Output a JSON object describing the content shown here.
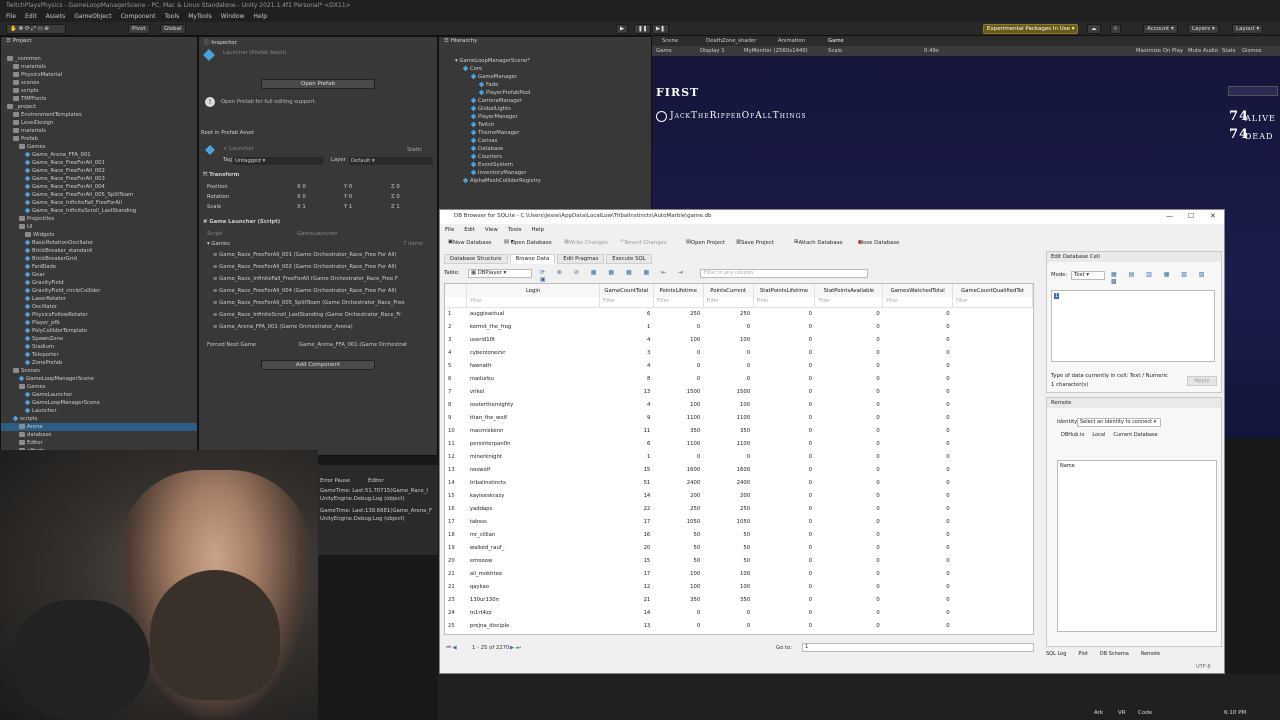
{
  "unity": {
    "title": "TwitchPlaysPhysics - GameLoopManagerScene - PC, Mac & Linux Standalone - Unity 2021.1.4f1 Personal* <DX11>",
    "menu": [
      "File",
      "Edit",
      "Assets",
      "GameObject",
      "Component",
      "Tools",
      "MyTools",
      "Window",
      "Help"
    ],
    "toolbar": {
      "pivot": "Pivot",
      "global": "Global",
      "experimental": "Experimental Packages In Use",
      "account": "Account",
      "layers": "Layers",
      "layout": "Layout"
    }
  },
  "project": {
    "tab": "Project",
    "items": [
      "_common",
      "materials",
      "PhysicsMaterial",
      "scenes",
      "scripts",
      "TMPFonts",
      "_project",
      "EnvironmentTemplates",
      "LevelDesign",
      "materials",
      "Prefab",
      "Games",
      "Game_Arena_FFA_001",
      "Game_Race_FreeForAll_001",
      "Game_Race_FreeForAll_002",
      "Game_Race_FreeForAll_003",
      "Game_Race_FreeForAll_004",
      "Game_Race_FreeForAll_005_SplitTeam",
      "Game_Race_InfiniteFall_FreeForAll",
      "Game_Race_InfiniteScroll_LastStanding",
      "Projectiles",
      "UI",
      "Widgets",
      "BasicRotationOscillator",
      "BrickBreaker_standard",
      "BrickBreakerGrid",
      "FanBlade",
      "Gear",
      "GravityField",
      "GravityField_circleCollider",
      "LaserRotator",
      "Oscillator",
      "PhysicsFollowRotator",
      "Player_pfb",
      "PolyColliderTemplate",
      "SpawnZone",
      "Stadium",
      "Teleporter",
      "ZonePrefab",
      "Scenes",
      "GameLoopManagerScene",
      "Games",
      "GameLauncher",
      "GameLoopManagerScene",
      "Launcher",
      "scripts",
      "Arena",
      "database",
      "Editor",
      "effects"
    ],
    "selected_index": 46
  },
  "inspector": {
    "tab": "Inspector",
    "asset_title": "Launcher (Prefab Asset)",
    "open_prefab": "Open Prefab",
    "info": "Open Prefab for full editing support.",
    "root_label": "Root in Prefab Asset",
    "object_name": "Launcher",
    "static": "Static",
    "tag_label": "Tag",
    "tag_value": "Untagged",
    "layer_label": "Layer",
    "layer_value": "Default",
    "transform": "Transform",
    "position": "Position",
    "rotation": "Rotation",
    "scale": "Scale",
    "pos_vals": [
      "0",
      "0",
      "0"
    ],
    "rot_vals": [
      "0",
      "0",
      "0"
    ],
    "scale_vals": [
      "1",
      "1",
      "1"
    ],
    "component": "Game Launcher (Script)",
    "script_label": "Script",
    "script_value": "GameLauncher",
    "games_label": "Games",
    "games_count": "7 items",
    "games": [
      "Game_Race_FreeForAll_001 (Game Orchestrator_Race_Free For All)",
      "Game_Race_FreeForAll_002 (Game Orchestrator_Race_Free For All)",
      "Game_Race_InfiniteFall_FreeForAll (Game Orchestrator_Race_Free F",
      "Game_Race_FreeForAll_004 (Game Orchestrator_Race_Free For All)",
      "Game_Race_FreeForAll_005_SplitTeam (Game Orchestrator_Race_Free",
      "Game_Race_InfiniteScroll_LastStanding (Game Orchestrator_Race_Fr",
      "Game_Arena_FFA_001 (Game Orchestrator_Arena)"
    ],
    "forced_label": "Forced Next Game",
    "forced_value": "Game_Arena_FFA_001 (Game Orchestrat",
    "add_component": "Add Component"
  },
  "hierarchy": {
    "tab": "Hierarchy",
    "scene": "GameLoopManagerScene*",
    "items": [
      "Core",
      "GameManager",
      "Fade",
      "PlayerPrefabPool",
      "CameraManager",
      "GlobalLights",
      "PlayerManager",
      "Twitch",
      "ThemeManager",
      "Canvas",
      "Database",
      "Counters",
      "EventSystem",
      "InventoryManager",
      "AlphaMeshColliderRegistry"
    ]
  },
  "sceneTabs": {
    "tabs": [
      "Scene",
      "DeathZone_shader",
      "Animation",
      "Game"
    ],
    "display": "Display 1",
    "resolution": "MyMonitor (2560x1440)",
    "scale_label": "Scale",
    "scale_value": "0.49x",
    "maximize": "Maximize On Play",
    "mute": "Mute Audio",
    "stats": "Stats",
    "gizmos": "Gizmos",
    "game_mode": "Game"
  },
  "game": {
    "first_label": "FIRST",
    "first_player": "JackTheRipperOfAllThings",
    "alive_count": "74",
    "alive_label": "ALIVE",
    "dead_count": "74",
    "dead_label": "DEAD"
  },
  "console": {
    "tabs": [
      "Error Pause",
      "Editor"
    ],
    "lines": [
      "GameTime: Last:51.70715(Game_Race_I",
      "UnityEngine.Debug:Log (object)",
      "GameTime: Last:138.6681(Game_Arena_F",
      "UnityEngine.Debug:Log (object)"
    ]
  },
  "db": {
    "title": "DB Browser for SQLite - C:\\Users\\Jesse\\AppData\\LocalLow\\TribalInstincts\\AutoMarble\\game.db",
    "menu": [
      "File",
      "Edit",
      "View",
      "Tools",
      "Help"
    ],
    "toolbar": [
      "New Database",
      "Open Database",
      "Write Changes",
      "Revert Changes",
      "Open Project",
      "Save Project",
      "Attach Database",
      "Close Database"
    ],
    "tabs": [
      "Database Structure",
      "Browse Data",
      "Edit Pragmas",
      "Execute SQL"
    ],
    "table_label": "Table:",
    "table_value": "DBPlayer",
    "filter_placeholder": "Filter in any column",
    "columns": [
      "Login",
      "GameCountTotal",
      "PointsLifetime",
      "PointsCurrent",
      "StatPointsLifetime",
      "StatPointsAvailable",
      "GamesWatchedTotal",
      "GameCountQualifiedTot"
    ],
    "filter_text": "Filter",
    "rows": [
      [
        "auggieactual",
        "6",
        "250",
        "250",
        "0",
        "0",
        "0"
      ],
      [
        "kermit_the_frog",
        "1",
        "0",
        "0",
        "0",
        "0",
        "0"
      ],
      [
        "userid10t",
        "4",
        "100",
        "100",
        "0",
        "0",
        "0"
      ],
      [
        "cyberzonezvr",
        "3",
        "0",
        "0",
        "0",
        "0",
        "0"
      ],
      [
        "fawnath",
        "4",
        "0",
        "0",
        "0",
        "0",
        "0"
      ],
      [
        "madurbu",
        "8",
        "0",
        "0",
        "0",
        "0",
        "0"
      ],
      [
        "vrikel",
        "13",
        "1500",
        "1500",
        "0",
        "0",
        "0"
      ],
      [
        "ossterthemighty",
        "4",
        "100",
        "100",
        "0",
        "0",
        "0"
      ],
      [
        "titan_the_wolf",
        "9",
        "1100",
        "1100",
        "0",
        "0",
        "0"
      ],
      [
        "macmiskenn",
        "11",
        "350",
        "350",
        "0",
        "0",
        "0"
      ],
      [
        "persinterpan0n",
        "6",
        "1100",
        "1100",
        "0",
        "0",
        "0"
      ],
      [
        "minerknight",
        "1",
        "0",
        "0",
        "0",
        "0",
        "0"
      ],
      [
        "noswolf",
        "15",
        "1600",
        "1600",
        "0",
        "0",
        "0"
      ],
      [
        "tribalinstincts",
        "51",
        "2400",
        "2400",
        "0",
        "0",
        "0"
      ],
      [
        "kayleeskrazy",
        "14",
        "200",
        "200",
        "0",
        "0",
        "0"
      ],
      [
        "yaddaps",
        "22",
        "250",
        "250",
        "0",
        "0",
        "0"
      ],
      [
        "tabsss",
        "17",
        "1050",
        "1050",
        "0",
        "0",
        "0"
      ],
      [
        "mr_cillian",
        "16",
        "50",
        "50",
        "0",
        "0",
        "0"
      ],
      [
        "walked_rauf_",
        "20",
        "50",
        "50",
        "0",
        "0",
        "0"
      ],
      [
        "emooow",
        "15",
        "50",
        "50",
        "0",
        "0",
        "0"
      ],
      [
        "ali_mokhtee",
        "17",
        "100",
        "100",
        "0",
        "0",
        "0"
      ],
      [
        "qaykao",
        "12",
        "100",
        "100",
        "0",
        "0",
        "0"
      ],
      [
        "130ur130n",
        "21",
        "350",
        "350",
        "0",
        "0",
        "0"
      ],
      [
        "m1rt4zz",
        "14",
        "0",
        "0",
        "0",
        "0",
        "0"
      ],
      [
        "prejna_disciple",
        "13",
        "0",
        "0",
        "0",
        "0",
        "0"
      ]
    ],
    "pager": "1 - 25 of 2270",
    "goto_label": "Go to:",
    "goto_value": "1",
    "edit_cell": {
      "title": "Edit Database Cell",
      "mode_label": "Mode:",
      "mode_value": "Text",
      "type_info": "Type of data currently in cell: Text / Numeric",
      "char_info": "1 character(s)",
      "apply": "Apply"
    },
    "remote": {
      "title": "Remote",
      "identity_label": "Identity",
      "identity_value": "Select an identity to connect",
      "tabs": [
        "DBHub.io",
        "Local",
        "Current Database"
      ],
      "name_col": "Name"
    },
    "bottom_tabs": [
      "SQL Log",
      "Plot",
      "DB Schema",
      "Remote"
    ],
    "encoding": "UTF-8"
  },
  "taskbar": {
    "items": [
      "Ark",
      "VR",
      "Code"
    ],
    "time": "6:10 PM"
  }
}
